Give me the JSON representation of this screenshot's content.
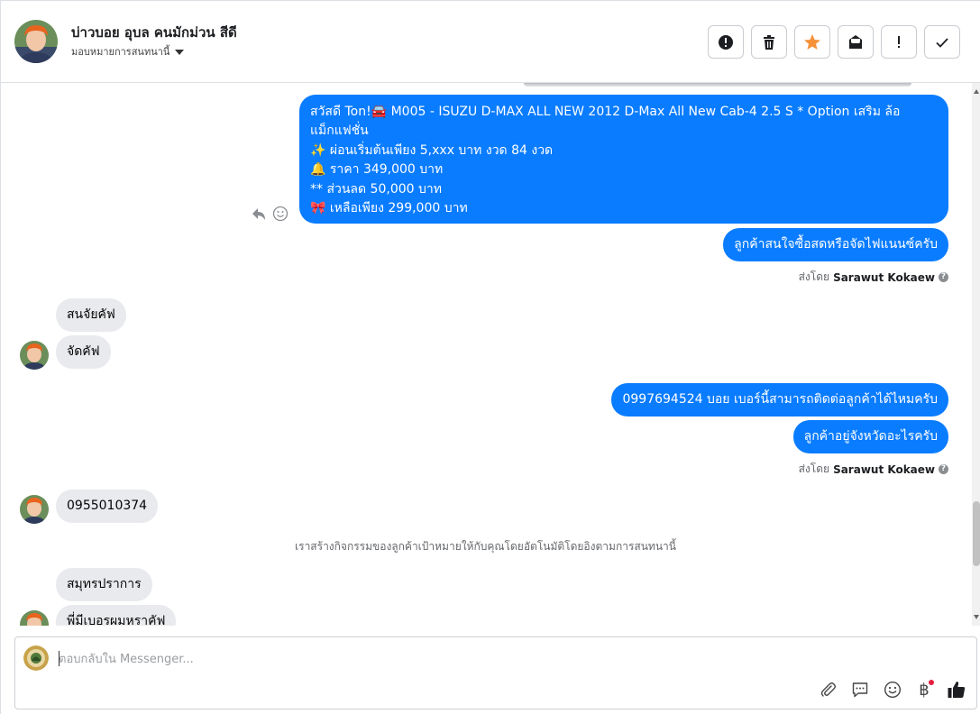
{
  "header": {
    "contact_name": "บ่าวบอย อุบล คนมักม่วน สีดี",
    "assign_label": "มอบหมายการสนทนานี้",
    "toolbar": [
      {
        "name": "mark-spam-button",
        "icon": "alert-circle-icon"
      },
      {
        "name": "delete-button",
        "icon": "trash-icon"
      },
      {
        "name": "star-button",
        "icon": "star-icon"
      },
      {
        "name": "mark-unread-button",
        "icon": "mail-icon"
      },
      {
        "name": "follow-up-button",
        "icon": "exclamation-icon"
      },
      {
        "name": "mark-done-button",
        "icon": "check-icon"
      }
    ]
  },
  "colors": {
    "outgoing_bubble": "#0a7cff",
    "incoming_bubble": "#e9eaed",
    "star": "#f7923b",
    "badge_dot": "#e41e3f"
  },
  "messages": {
    "promo_lines": [
      "สวัสดี Ton!🚘 M005 - ISUZU D-MAX ALL NEW 2012 D-Max All New Cab-4 2.5 S  * Option เสริม ล้อ",
      "แม็กแฟชั่น",
      "✨ ผ่อนเริ่มต้นเพียง 5,xxx บาท งวด 84 งวด",
      "🔔  ราคา 349,000 บาท",
      "** ส่วนลด 50,000 บาท",
      "🎀 เหลือเพียง 299,000 บาท"
    ],
    "out_1": "ลูกค้าสนใจซื้อสดหรือจัดไฟแนนซ์ครับ",
    "sent_by_label": "ส่งโดย",
    "sent_by_name": "Sarawut Kokaew",
    "in_1": "สนจัยคัฟ",
    "in_2": "จัดคัฟ",
    "out_2": "0997694524  บอย เบอร์นี้สามารถติดต่อลูกค้าได้ไหมครับ",
    "out_3": "ลูกค้าอยู่จังหวัดอะไรครับ",
    "in_3": "0955010374",
    "system_note": "เราสร้างกิจกรรมของลูกค้าเป้าหมายให้กับคุณโดยอัตโนมัติโดยอิงตามการสนทนานี้",
    "in_4": "สมุทรปราการ",
    "in_5": "พี่มีเบอรผมหราคัฟ"
  },
  "composer": {
    "placeholder": "ตอบกลับใน Messenger...",
    "icons": [
      "paperclip-icon",
      "saved-reply-icon",
      "emoji-icon",
      "baht-icon",
      "thumbs-up-icon"
    ],
    "baht_symbol": "฿"
  }
}
